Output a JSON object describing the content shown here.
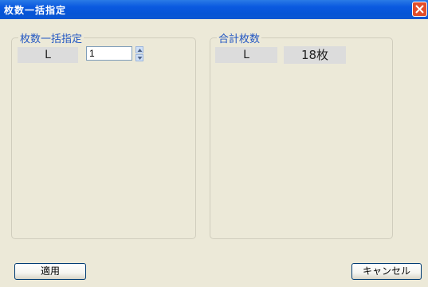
{
  "window": {
    "title": "枚数一括指定"
  },
  "left_group": {
    "legend": "枚数一括指定",
    "size_label": "L",
    "quantity_value": "1"
  },
  "right_group": {
    "legend": "合計枚数",
    "size_label": "L",
    "total_count": "18枚"
  },
  "buttons": {
    "apply": "適用",
    "cancel": "キャンセル"
  },
  "icons": {
    "close": "close-icon",
    "spin_up": "arrow-up-icon",
    "spin_down": "arrow-down-icon"
  },
  "colors": {
    "titlebar": "#0b5ae0",
    "close_button": "#e24e2a",
    "legend_text": "#2256c2",
    "window_bg": "#ece9d8"
  }
}
